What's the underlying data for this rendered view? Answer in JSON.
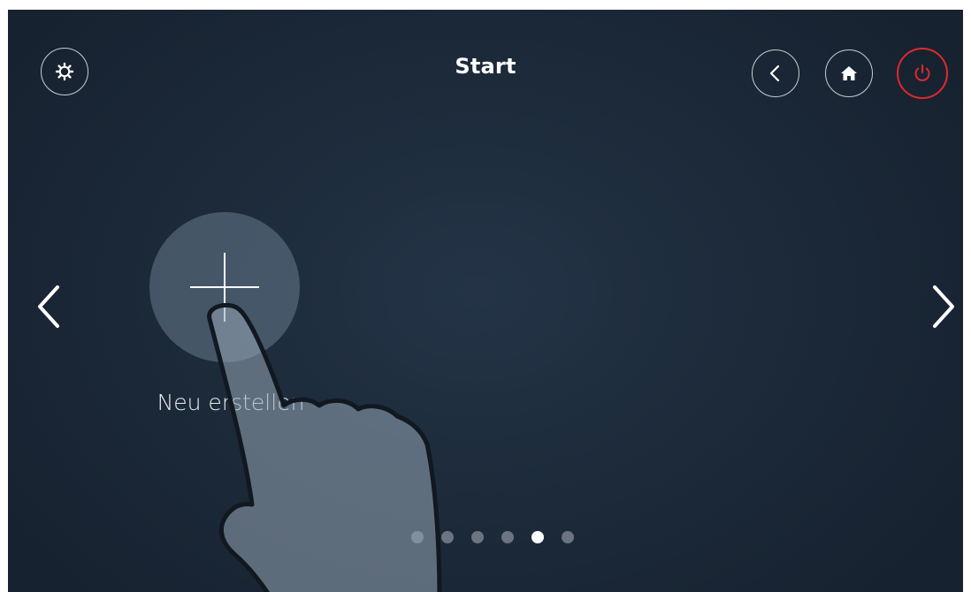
{
  "header": {
    "title": "Start"
  },
  "tiles": [
    {
      "label": "Neu erstellen",
      "icon": "plus-icon"
    }
  ],
  "pagination": {
    "total": 6,
    "active_index": 4
  },
  "icons": {
    "settings": "gear-icon",
    "back": "chevron-left-icon",
    "home": "home-icon",
    "power": "power-icon",
    "prev": "chevron-left-icon",
    "next": "chevron-right-icon",
    "pointer": "hand-pointer-icon"
  },
  "colors": {
    "background": "#1d2b3b",
    "power_accent": "#e0282e",
    "dot_active": "#ffffff",
    "dot_inactive": "#6b7480"
  }
}
